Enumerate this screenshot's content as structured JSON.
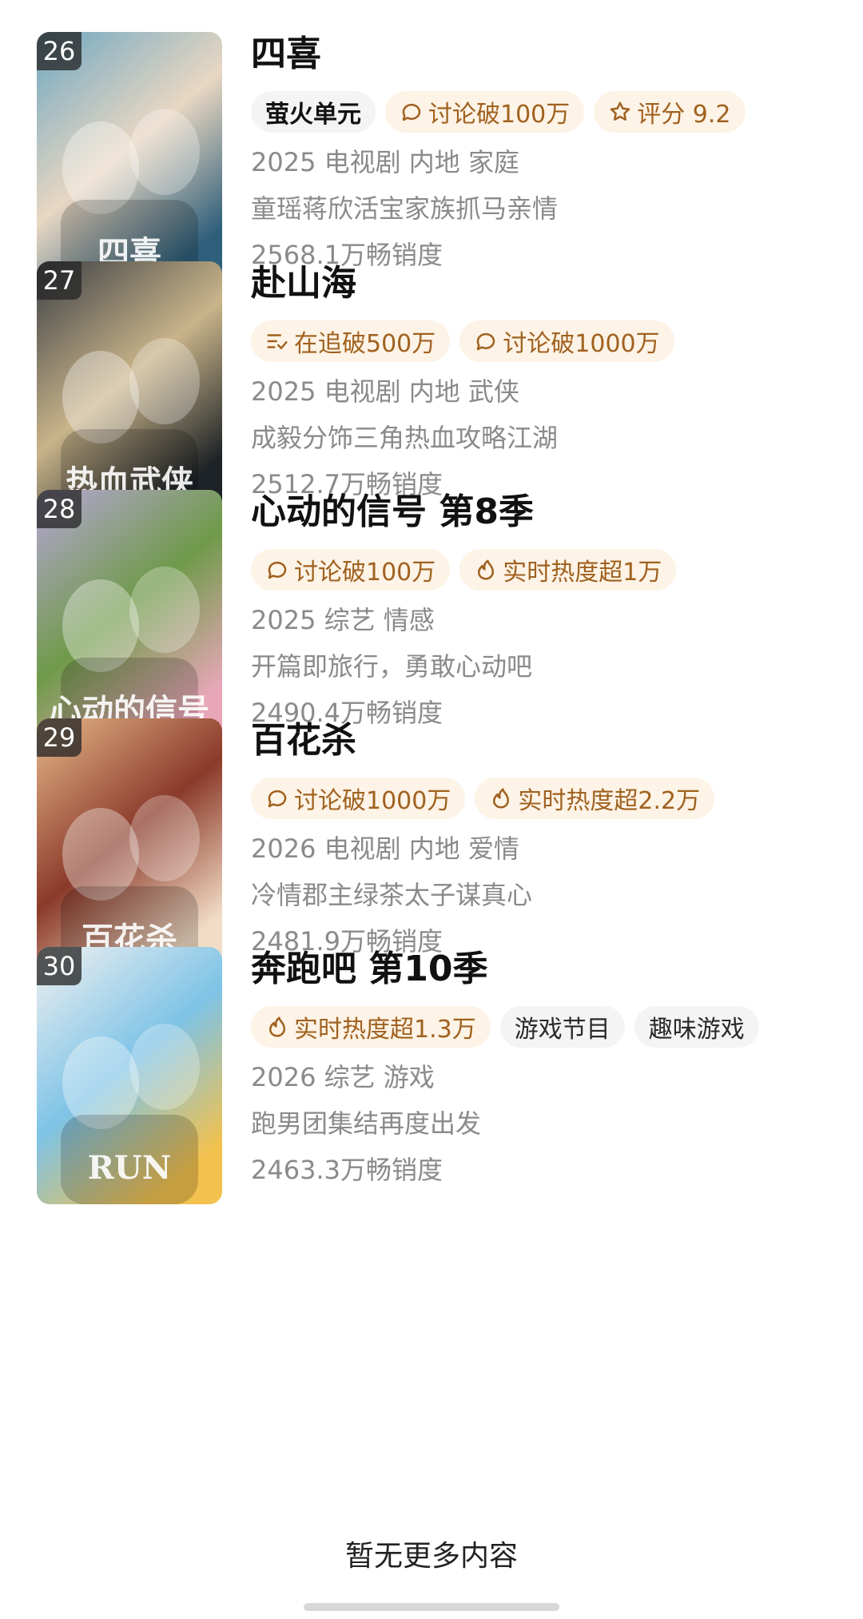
{
  "items": [
    {
      "rank": "26",
      "title": "四喜",
      "tags": [
        {
          "icon": "brand-logo",
          "label": "萤火单元",
          "style": "brand"
        },
        {
          "icon": "comment-icon",
          "label": "讨论破100万",
          "style": "warm"
        },
        {
          "icon": "star-icon",
          "label": "评分 9.2",
          "style": "warm"
        }
      ],
      "meta": "2025 电视剧 内地 家庭",
      "desc": "童瑶蒋欣活宝家族抓马亲情",
      "popularity": "2568.1万畅销度",
      "poster_colors": [
        "#6fa7c2",
        "#e8d7c2",
        "#2f5f7a"
      ],
      "poster_text": "四喜"
    },
    {
      "rank": "27",
      "title": "赴山海",
      "tags": [
        {
          "icon": "list-check-icon",
          "label": "在追破500万",
          "style": "warm"
        },
        {
          "icon": "comment-icon",
          "label": "讨论破1000万",
          "style": "warm"
        }
      ],
      "meta": "2025 电视剧 内地 武侠",
      "desc": "成毅分饰三角热血攻略江湖",
      "popularity": "2512.7万畅销度",
      "poster_colors": [
        "#3b3f44",
        "#c9b48a",
        "#1d2226"
      ],
      "poster_text": "热血武侠"
    },
    {
      "rank": "28",
      "title": "心动的信号 第8季",
      "tags": [
        {
          "icon": "comment-icon",
          "label": "讨论破100万",
          "style": "warm"
        },
        {
          "icon": "flame-icon",
          "label": "实时热度超1万",
          "style": "warm"
        }
      ],
      "meta": "2025 综艺 情感",
      "desc": "开篇即旅行，勇敢心动吧",
      "popularity": "2490.4万畅销度",
      "poster_colors": [
        "#b7a6d6",
        "#6f9a4a",
        "#e8a7b8"
      ],
      "poster_text": "心动的信号"
    },
    {
      "rank": "29",
      "title": "百花杀",
      "tags": [
        {
          "icon": "comment-icon",
          "label": "讨论破1000万",
          "style": "warm"
        },
        {
          "icon": "flame-icon",
          "label": "实时热度超2.2万",
          "style": "warm"
        }
      ],
      "meta": "2026 电视剧 内地 爱情",
      "desc": "冷情郡主绿茶太子谋真心",
      "popularity": "2481.9万畅销度",
      "poster_colors": [
        "#e6b98a",
        "#8b3a2a",
        "#f2dcc6"
      ],
      "poster_text": "百花杀"
    },
    {
      "rank": "30",
      "title": "奔跑吧 第10季",
      "tags": [
        {
          "icon": "flame-icon",
          "label": "实时热度超1.3万",
          "style": "warm"
        },
        {
          "icon": "",
          "label": "游戏节目",
          "style": "plain"
        },
        {
          "icon": "",
          "label": "趣味游戏",
          "style": "plain"
        }
      ],
      "meta": "2026 综艺 游戏",
      "desc": "跑男团集结再度出发",
      "popularity": "2463.3万畅销度",
      "poster_colors": [
        "#f1f1f1",
        "#7ec3e6",
        "#f2c14e"
      ],
      "poster_text": "RUN"
    }
  ],
  "footer": {
    "text": "暂无更多内容"
  }
}
